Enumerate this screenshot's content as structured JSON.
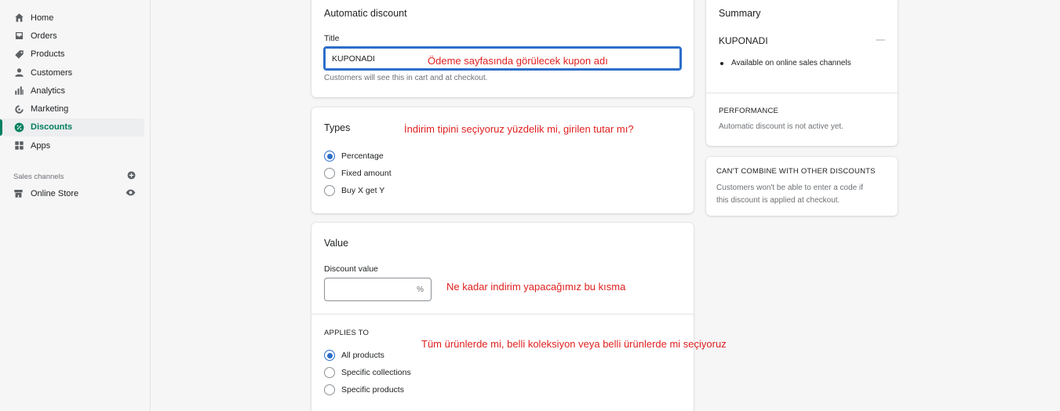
{
  "sidebar": {
    "items": [
      {
        "label": "Home",
        "icon": "home-icon"
      },
      {
        "label": "Orders",
        "icon": "orders-icon"
      },
      {
        "label": "Products",
        "icon": "tag-icon"
      },
      {
        "label": "Customers",
        "icon": "person-icon"
      },
      {
        "label": "Analytics",
        "icon": "bar-chart-icon"
      },
      {
        "label": "Marketing",
        "icon": "target-icon"
      },
      {
        "label": "Discounts",
        "icon": "discount-icon",
        "active": true
      },
      {
        "label": "Apps",
        "icon": "apps-icon"
      }
    ],
    "sales_channels_label": "Sales channels",
    "online_store_label": "Online Store"
  },
  "discount_card": {
    "title": "Automatic discount",
    "title_label": "Title",
    "title_value": "KUPONADI",
    "title_help": "Customers will see this in cart and at checkout."
  },
  "types_card": {
    "title": "Types",
    "options": [
      "Percentage",
      "Fixed amount",
      "Buy X get Y"
    ],
    "selected": 0
  },
  "value_card": {
    "title": "Value",
    "discount_value_label": "Discount value",
    "discount_value": "",
    "suffix": "%",
    "applies_to_label": "APPLIES TO",
    "applies_options": [
      "All products",
      "Specific collections",
      "Specific products"
    ],
    "applies_selected": 0
  },
  "summary_card": {
    "title": "Summary",
    "name": "KUPONADI",
    "bullet": "Available on online sales channels",
    "performance_label": "PERFORMANCE",
    "performance_text": "Automatic discount is not active yet."
  },
  "combine_card": {
    "title": "CAN'T COMBINE WITH OTHER DISCOUNTS",
    "text_line1": "Customers won't be able to enter a code if",
    "text_line2": "this discount is applied at checkout."
  },
  "annotations": {
    "title_note": "Ödeme sayfasında görülecek kupon adı",
    "types_note": "İndirim tipini seçiyoruz yüzdelik mi, girilen tutar mı?",
    "value_note": "Ne kadar indirim yapacağımız bu kısma",
    "applies_note": "Tüm ürünlerde mi, belli koleksiyon veya belli ürünlerde mi seçiyoruz"
  },
  "colors": {
    "accent": "#2c6ecb",
    "active_nav": "#008060",
    "annotation": "#e02020"
  }
}
